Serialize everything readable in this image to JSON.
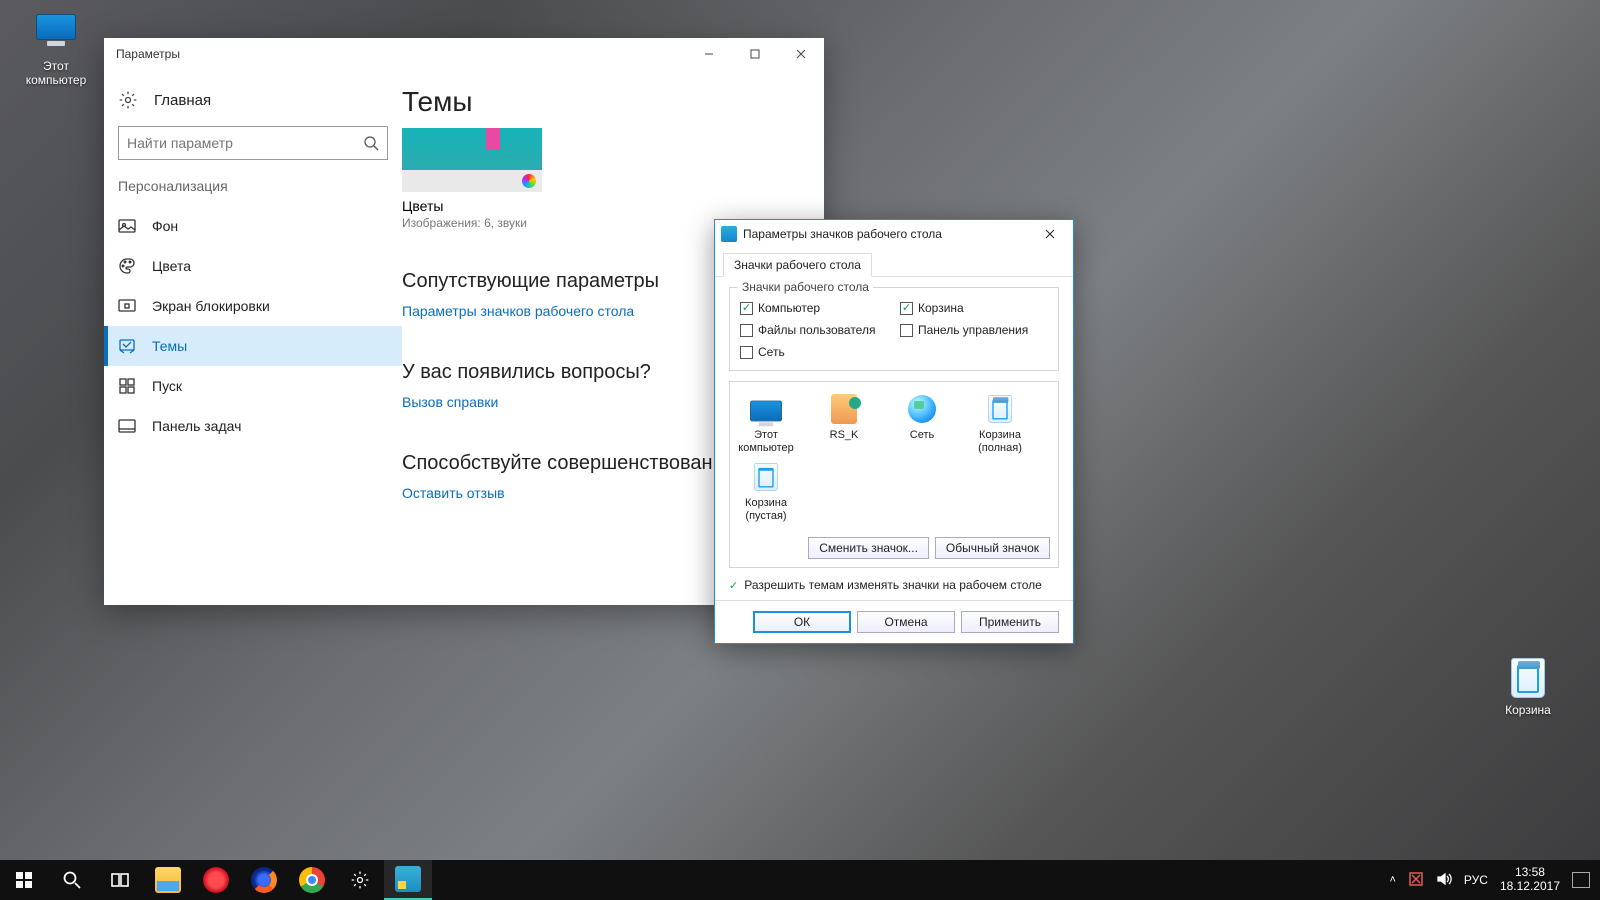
{
  "desktop": {
    "pc_label": "Этот\nкомпьютер",
    "bin_label": "Корзина"
  },
  "settings": {
    "title": "Параметры",
    "home": "Главная",
    "search_placeholder": "Найти параметр",
    "section": "Персонализация",
    "nav": {
      "background": "Фон",
      "colors": "Цвета",
      "lockscreen": "Экран блокировки",
      "themes": "Темы",
      "start": "Пуск",
      "taskbar": "Панель задач"
    },
    "main": {
      "heading": "Темы",
      "theme_name": "Цветы",
      "theme_meta": "Изображения: 6, звуки",
      "related_heading": "Сопутствующие параметры",
      "related_link": "Параметры значков рабочего стола",
      "help_heading": "У вас появились вопросы?",
      "help_link": "Вызов справки",
      "feedback_heading": "Способствуйте совершенствованию",
      "feedback_link": "Оставить отзыв"
    }
  },
  "dialog": {
    "title": "Параметры значков рабочего стола",
    "tab": "Значки рабочего стола",
    "group_legend": "Значки рабочего стола",
    "checks": {
      "computer": "Компьютер",
      "user_files": "Файлы пользователя",
      "network": "Сеть",
      "recycle": "Корзина",
      "control_panel": "Панель управления"
    },
    "icons": {
      "this_pc": "Этот\nкомпьютер",
      "user": "RS_K",
      "network": "Сеть",
      "bin_full": "Корзина\n(полная)",
      "bin_empty": "Корзина\n(пустая)"
    },
    "change_icon_btn": "Сменить значок...",
    "default_icon_btn": "Обычный значок",
    "allow_themes": "Разрешить темам изменять значки на рабочем столе",
    "ok": "ОК",
    "cancel": "Отмена",
    "apply": "Применить"
  },
  "taskbar": {
    "lang": "РУС",
    "time": "13:58",
    "date": "18.12.2017"
  }
}
